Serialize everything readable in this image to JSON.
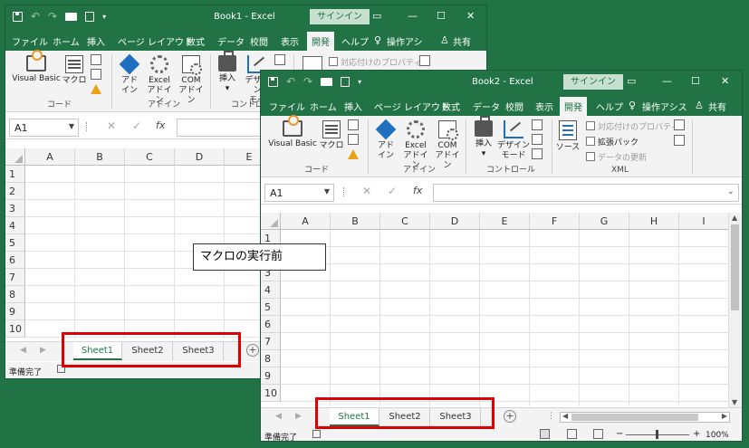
{
  "window1": {
    "title": "Book1 - Excel",
    "signin": "サインイン",
    "tabs": [
      "ファイル",
      "ホーム",
      "挿入",
      "ページ レイアウト",
      "数式",
      "データ",
      "校閲",
      "表示",
      "開発",
      "ヘルプ",
      "操作アシ",
      "共有"
    ],
    "active_tab": "開発",
    "ribbon": {
      "visual_basic": "Visual Basic",
      "macro": "マクロ",
      "addin_1": "アド",
      "addin_2": "イン",
      "excel_addin_1": "Excel",
      "excel_addin_2": "アドイン",
      "com_addin_1": "COM",
      "com_addin_2": "アドイン",
      "insert": "挿入",
      "design_1": "デザイン",
      "design_2": "モー",
      "props": "対応付けのプロパティ",
      "group_code": "コード",
      "group_addin": "アドイン",
      "group_control": "コントロー"
    },
    "namebox": "A1",
    "columns": [
      "A",
      "B",
      "C",
      "D",
      "E"
    ],
    "rows": [
      "1",
      "2",
      "3",
      "4",
      "5",
      "6",
      "7",
      "8",
      "9",
      "10"
    ],
    "sheets": [
      "Sheet1",
      "Sheet2",
      "Sheet3"
    ],
    "active_sheet": "Sheet1",
    "status": "準備完了"
  },
  "window2": {
    "title": "Book2 - Excel",
    "signin": "サインイン",
    "tabs": [
      "ファイル",
      "ホーム",
      "挿入",
      "ページ レイアウト",
      "数式",
      "データ",
      "校閲",
      "表示",
      "開発",
      "ヘルプ",
      "操作アシス",
      "共有"
    ],
    "active_tab": "開発",
    "ribbon": {
      "visual_basic": "Visual Basic",
      "macro": "マクロ",
      "addin_1": "アド",
      "addin_2": "イン",
      "excel_addin_1": "Excel",
      "excel_addin_2": "アドイン",
      "com_addin_1": "COM",
      "com_addin_2": "アドイン",
      "insert": "挿入",
      "design_1": "デザイン",
      "design_2": "モード",
      "source": "ソース",
      "props": "対応付けのプロパティ",
      "expansion": "拡張パック",
      "refresh": "データの更新",
      "group_code": "コード",
      "group_addin": "アドイン",
      "group_control": "コントロール",
      "group_xml": "XML"
    },
    "namebox": "A1",
    "columns": [
      "A",
      "B",
      "C",
      "D",
      "E",
      "F",
      "G",
      "H",
      "I"
    ],
    "rows": [
      "1",
      "2",
      "3",
      "4",
      "5",
      "6",
      "7",
      "8",
      "9",
      "10"
    ],
    "sheets": [
      "Sheet1",
      "Sheet2",
      "Sheet3"
    ],
    "active_sheet": "Sheet1",
    "status": "準備完了",
    "zoom": "100%"
  },
  "callout": "マクロの実行前",
  "colors": {
    "excel_green": "#217346",
    "highlight_red": "#e00000"
  }
}
